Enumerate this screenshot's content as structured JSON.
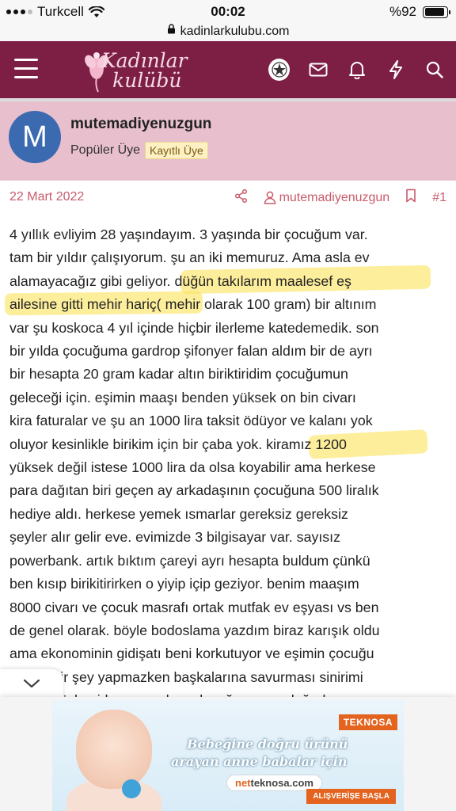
{
  "status_bar": {
    "carrier": "Turkcell",
    "time": "00:02",
    "battery": "%92",
    "battery_level": 0.92
  },
  "url_bar": {
    "url": "kadinlarkulubu.com",
    "icon": "lock-icon"
  },
  "header": {
    "logo_line1": "Kadınlar",
    "logo_line2": "kulübü",
    "icons": [
      "menu-icon",
      "user-avatar-icon",
      "mail-icon",
      "bell-icon",
      "bolt-icon",
      "search-icon"
    ],
    "accent_color": "#7d1f45"
  },
  "user": {
    "avatar_letter": "M",
    "avatar_color": "#3b6ab0",
    "name": "mutemadiyenuzgun",
    "title": "Popüler Üye",
    "badge": "Kayıtlı Üye",
    "block_color": "#e8bfcd"
  },
  "post": {
    "date": "22 Mart 2022",
    "author": "mutemadiyenuzgun",
    "number": "#1",
    "link_color": "#c95b6b",
    "lines": [
      "4 yıllık evliyim 28 yaşındayım. 3 yaşında bir çocuğum var.",
      "tam bir yıldır çalışıyorum. şu an iki memuruz. Ama asla ev",
      "alamayacağız gibi geliyor. düğün takılarım maalesef eş",
      "ailesine gitti mehir hariç( mehir olarak 100 gram) bir altınım",
      "var şu koskoca 4 yıl içinde hiçbir ilerleme katedemedik. son",
      "bir yılda çocuğuma gardrop şifonyer falan aldım bir de ayrı",
      "bir hesapta 20 gram kadar altın biriktiridim çocuğumun",
      "geleceği için. eşimin maaşı benden yüksek on bin civarı",
      "kira faturalar ve şu an 1000 lira taksit ödüyor ve kalanı yok",
      "oluyor kesinlikle birikim için bir çaba yok. kiramız 1200",
      "yüksek değil istese 1000 lira da olsa koyabilir ama herkese",
      "para dağıtan biri geçen ay arkadaşının çocuğuna 500 liralık",
      "hediye aldı. herkese yemek ısmarlar gereksiz gereksiz",
      "şeyler alır gelir eve. evimizde 3 bilgisayar var. sayısız",
      "powerbank. artık bıktım çareyi ayrı hesapta buldum çünkü",
      "ben kısıp birikitirirken o yiyip içip geziyor. benim maaşım",
      "8000 civarı ve çocuk masrafı ortak mutfak ev eşyası vs ben",
      "de genel olarak. böyle bodoslama yazdım biraz karışık oldu",
      "ama ekonominin gidişatı beni korkutuyor ve eşimin çocuğu",
      "için hiçbir şey yapmazken başkalarına savurması sinirimi",
      "bozar. böyle giderse nasıl ev alacağız şu an doğudayız"
    ],
    "highlight_color": "#fce460"
  },
  "ad": {
    "brand": "TEKNOSA",
    "line1": "Bebeğine doğru ürünü",
    "line2": "arayan anne babalar için",
    "url_prefix": "net",
    "url_main": "teknosa.com",
    "cta": "ALIŞVERİŞE BAŞLA"
  }
}
